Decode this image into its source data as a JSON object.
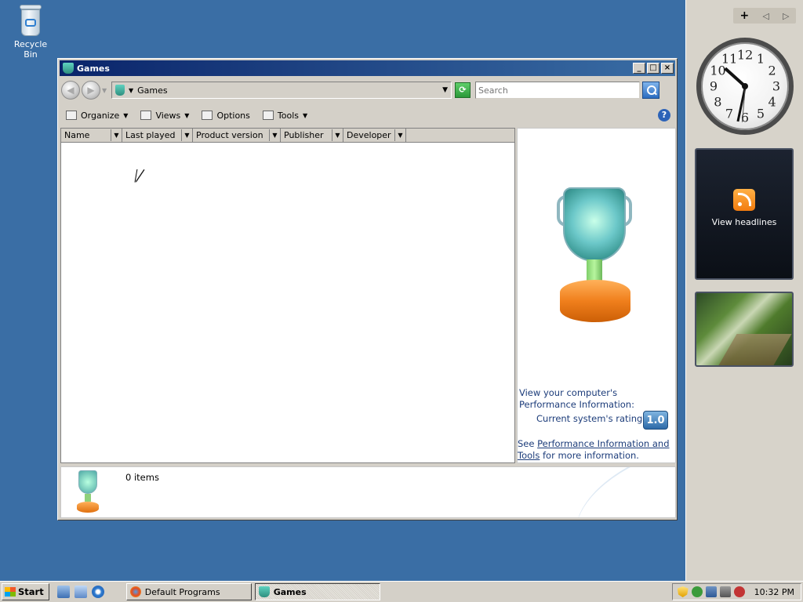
{
  "desktop": {
    "recycle_bin_label": "Recycle Bin"
  },
  "sidebar": {
    "add_gadget": "+",
    "prev": "◁",
    "next": "▷",
    "clock_numbers": [
      "12",
      "1",
      "2",
      "3",
      "4",
      "5",
      "6",
      "7",
      "8",
      "9",
      "10",
      "11"
    ],
    "feed_title": "View headlines"
  },
  "window": {
    "title": "Games",
    "minimize": "_",
    "maximize": "□",
    "close": "×",
    "address": "Games",
    "search_placeholder": "Search",
    "toolbar": {
      "organize": "Organize",
      "views": "Views",
      "options": "Options",
      "tools": "Tools",
      "help": "?"
    },
    "columns": [
      "Name",
      "Last played",
      "Product version",
      "Publisher",
      "Developer"
    ],
    "info": {
      "perf_text": "View your computer's Performance Information:",
      "rating_label": "Current system's rating:",
      "rating_value": "1.0",
      "see_prefix": "See ",
      "see_link": "Performance Information and Tools",
      "see_suffix": " for more information."
    },
    "details": {
      "count": "0 items"
    }
  },
  "taskbar": {
    "start": "Start",
    "tasks": [
      "Default Programs",
      "Games"
    ],
    "time": "10:32 PM"
  },
  "colors": {
    "desktop": "#3a6ea5",
    "title_start": "#0a246a",
    "title_end": "#3a6ea5",
    "link_text": "#1c3c7a"
  }
}
